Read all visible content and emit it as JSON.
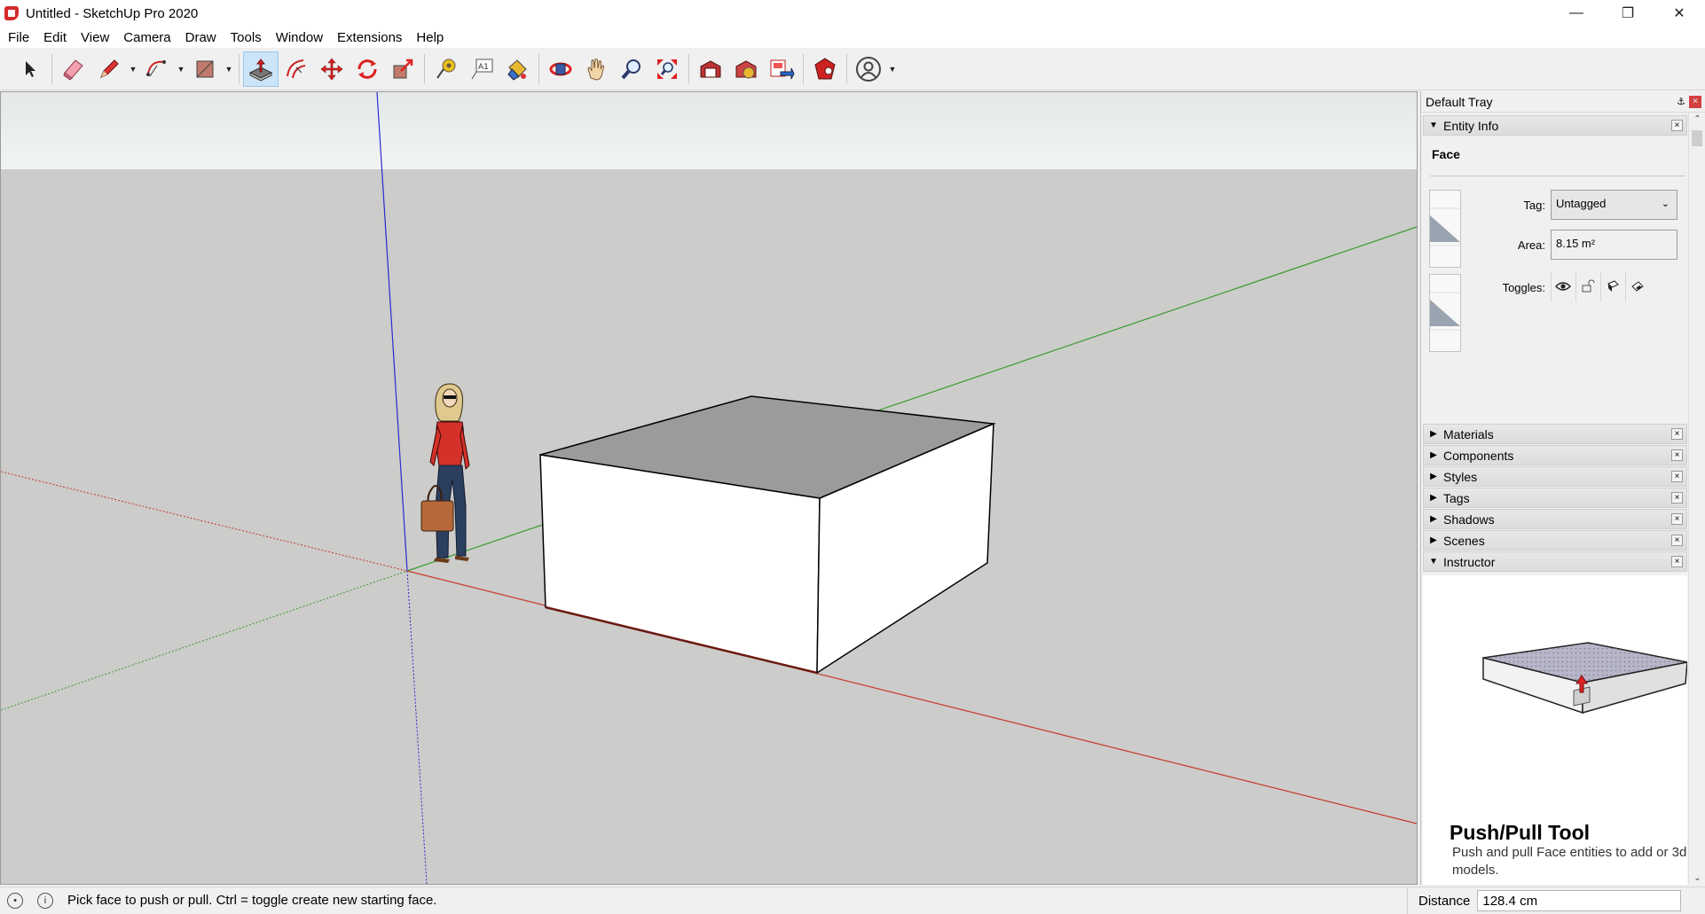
{
  "window": {
    "title": "Untitled - SketchUp Pro 2020",
    "minimize": "—",
    "restore": "❐",
    "close": "✕"
  },
  "menu": [
    "File",
    "Edit",
    "View",
    "Camera",
    "Draw",
    "Tools",
    "Window",
    "Extensions",
    "Help"
  ],
  "toolbar": {
    "tools": [
      "select-icon",
      "eraser-icon",
      "pencil-line-icon",
      "arc-icon",
      "rectangle-icon",
      "push-pull-icon",
      "offset-icon",
      "move-icon",
      "rotate-icon",
      "scale-icon",
      "tape-measure-icon",
      "text-icon",
      "paint-bucket-icon",
      "orbit-icon",
      "pan-icon",
      "zoom-icon",
      "zoom-extents-icon",
      "warehouse-icon",
      "extension-warehouse-icon",
      "send-to-layout-icon",
      "extension-manager-icon",
      "account-icon"
    ],
    "active_tool": "push-pull-icon",
    "text_tool_label": "A1"
  },
  "tray": {
    "title": "Default Tray",
    "pin": "⚓",
    "close": "×",
    "entity_info": {
      "label": "Entity Info",
      "type": "Face",
      "tag_label": "Tag:",
      "tag_value": "Untagged",
      "area_label": "Area:",
      "area_value": "8.15 m²",
      "toggles_label": "Toggles:"
    },
    "panels": [
      "Materials",
      "Components",
      "Styles",
      "Tags",
      "Shadows",
      "Scenes"
    ],
    "instructor": {
      "label": "Instructor",
      "tool_title": "Push/Pull Tool",
      "tool_description": "Push and pull Face entities to add or 3d models."
    }
  },
  "status": {
    "message": "Pick face to push or pull.  Ctrl = toggle create new starting face.",
    "vcb_label": "Distance",
    "vcb_value": "128.4 cm"
  },
  "colors": {
    "accent_active": "#cce4f7",
    "axis_red": "#c43a2e",
    "axis_green": "#3a9a2e",
    "axis_blue": "#2a2ad0",
    "viewport_ground": "#ccccca",
    "sky": "#e9ecec",
    "face_top": "#9b9b9b",
    "face_front": "#ffffff"
  }
}
